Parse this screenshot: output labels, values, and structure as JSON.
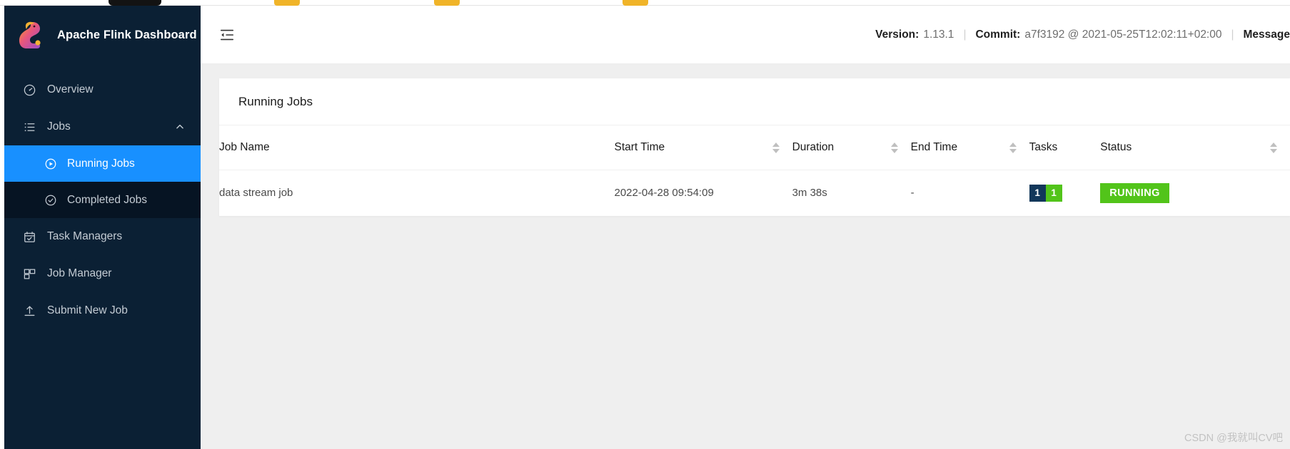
{
  "sidebar": {
    "brand": {
      "title": "Apache Flink Dashboard",
      "logo_icon": "flink-squirrel-logo"
    },
    "items": [
      {
        "label": "Overview",
        "icon": "dashboard-gauge-icon",
        "active": false,
        "sub": false
      },
      {
        "label": "Jobs",
        "icon": "list-icon",
        "active": false,
        "sub": false,
        "expanded": true,
        "chevron": "chevron-up-icon"
      },
      {
        "label": "Running Jobs",
        "icon": "play-circle-icon",
        "active": true,
        "sub": true
      },
      {
        "label": "Completed Jobs",
        "icon": "check-circle-icon",
        "active": false,
        "sub": true
      },
      {
        "label": "Task Managers",
        "icon": "calendar-check-icon",
        "active": false,
        "sub": false
      },
      {
        "label": "Job Manager",
        "icon": "cluster-blocks-icon",
        "active": false,
        "sub": false
      },
      {
        "label": "Submit New Job",
        "icon": "upload-icon",
        "active": false,
        "sub": false
      }
    ]
  },
  "topbar": {
    "fold_icon": "menu-fold-icon",
    "version_key": "Version:",
    "version_value": "1.13.1",
    "commit_key": "Commit:",
    "commit_value": "a7f3192 @ 2021-05-25T12:02:11+02:00",
    "message_key": "Message",
    "separator": "|"
  },
  "content": {
    "card_title": "Running Jobs",
    "columns": [
      {
        "label": "Job Name",
        "sortable": false
      },
      {
        "label": "Start Time",
        "sortable": true
      },
      {
        "label": "Duration",
        "sortable": true
      },
      {
        "label": "End Time",
        "sortable": true
      },
      {
        "label": "Tasks",
        "sortable": false
      },
      {
        "label": "Status",
        "sortable": true
      }
    ],
    "rows": [
      {
        "job_name": "data stream job",
        "start_time": "2022-04-28 09:54:09",
        "duration": "3m 38s",
        "end_time": "-",
        "tasks_total": "1",
        "tasks_running": "1",
        "status": "RUNNING"
      }
    ]
  },
  "watermark": {
    "text": "CSDN @我就叫CV吧"
  },
  "colors": {
    "sidebar_bg": "#0b2034",
    "sidebar_sub_bg": "#061423",
    "accent_blue": "#1890ff",
    "status_green": "#52c41a",
    "tasks_navy": "#12375a",
    "content_bg": "#efefef"
  }
}
